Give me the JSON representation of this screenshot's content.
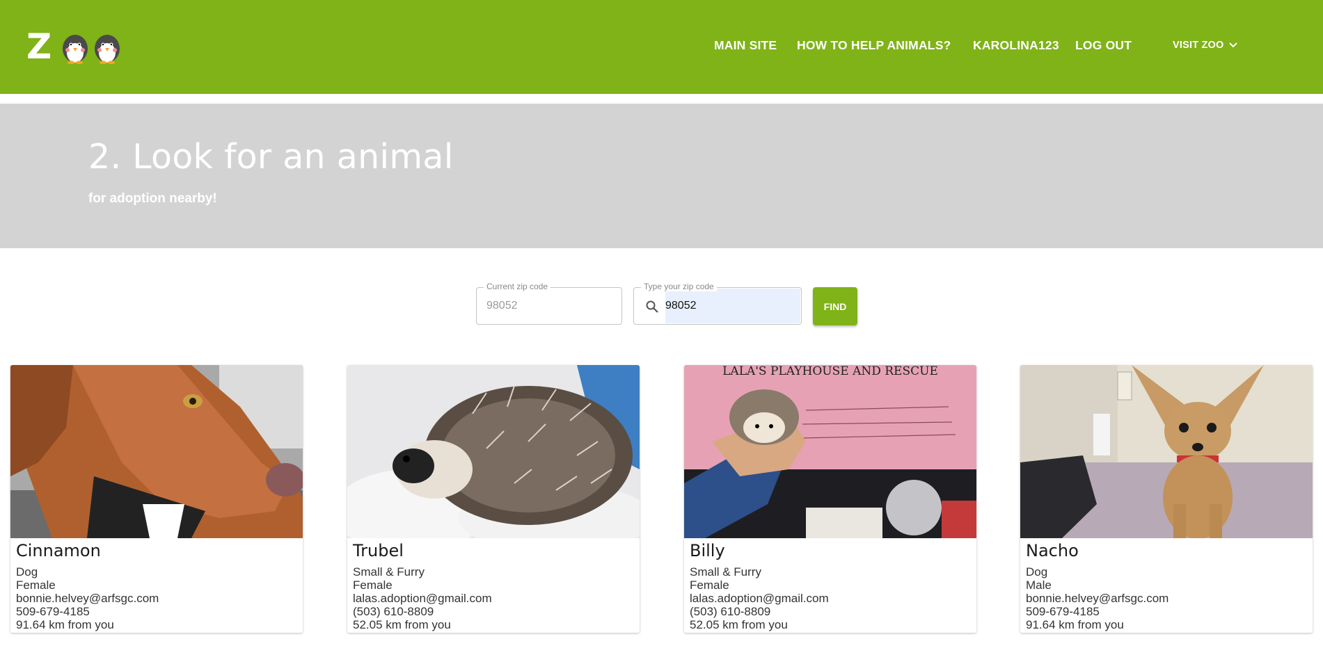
{
  "header": {
    "logo_letter": "Z",
    "nav": [
      {
        "label": "MAIN SITE"
      },
      {
        "label": "HOW TO HELP ANIMALS?"
      },
      {
        "label": "KAROLINA123"
      },
      {
        "label": "LOG OUT"
      },
      {
        "label": "VISIT ZOO"
      }
    ],
    "icon_visit": "chevron-down-icon"
  },
  "hero": {
    "title": "2. Look for an animal",
    "subtitle": "for adoption nearby!"
  },
  "search": {
    "current_label": "Current zip code",
    "current_value": "98052",
    "type_label": "Type your zip code",
    "type_value": "98052",
    "find_label": "FIND",
    "icon": "search-icon"
  },
  "animals": [
    {
      "name": "Cinnamon",
      "type": "Dog",
      "gender": "Female",
      "email": "bonnie.helvey@arfsgc.com",
      "phone": "509-679-4185",
      "distance": "91.64 km from you"
    },
    {
      "name": "Trubel",
      "type": "Small & Furry",
      "gender": "Female",
      "email": "lalas.adoption@gmail.com",
      "phone": "(503) 610-8809",
      "distance": "52.05 km from you"
    },
    {
      "name": "Billy",
      "type": "Small & Furry",
      "gender": "Female",
      "email": "lalas.adoption@gmail.com",
      "phone": "(503) 610-8809",
      "distance": "52.05 km from you"
    },
    {
      "name": "Nacho",
      "type": "Dog",
      "gender": "Male",
      "email": "bonnie.helvey@arfsgc.com",
      "phone": "509-679-4185",
      "distance": "91.64 km from you"
    }
  ],
  "photo_sign_text": "LALA'S PLAYHOUSE AND RESCUE",
  "colors": {
    "brand": "#7fb317",
    "hero": "#d3d3d3"
  }
}
